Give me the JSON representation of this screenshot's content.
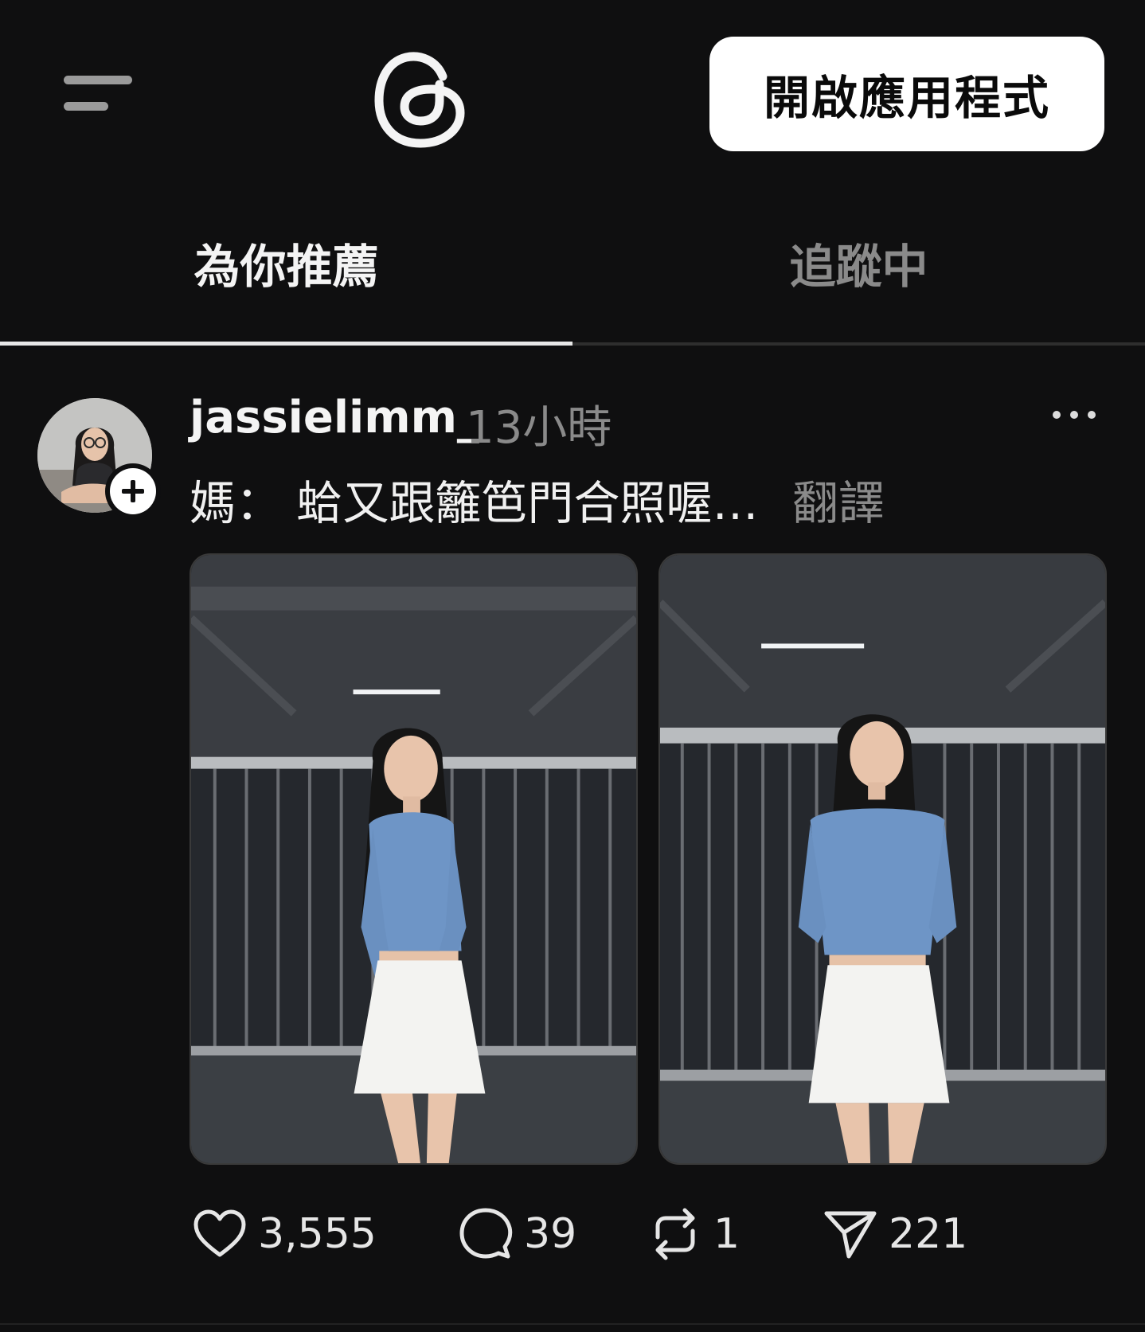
{
  "header": {
    "menu_icon": "hamburger-menu-icon",
    "logo_icon": "threads-logo-icon",
    "open_app_label": "開啟應用程式"
  },
  "tabs": [
    {
      "label": "為你推薦",
      "active": true
    },
    {
      "label": "追蹤中",
      "active": false
    }
  ],
  "post": {
    "username": "jassielimm_",
    "time": "13小時",
    "caption": "媽： 蛤又跟籬笆門合照喔…",
    "translate_label": "翻譯",
    "more_icon": "more-options-icon",
    "follow_icon": "plus-icon",
    "images": [
      "photo-1",
      "photo-2"
    ],
    "stats": {
      "likes": "3,555",
      "replies": "39",
      "reposts": "1",
      "shares": "221"
    }
  },
  "colors": {
    "background": "#0f0f10",
    "text_primary": "#f4f4f4",
    "text_secondary": "#8a8a8a",
    "button_bg": "#ffffff",
    "shirt_blue": "#6e95c6"
  }
}
